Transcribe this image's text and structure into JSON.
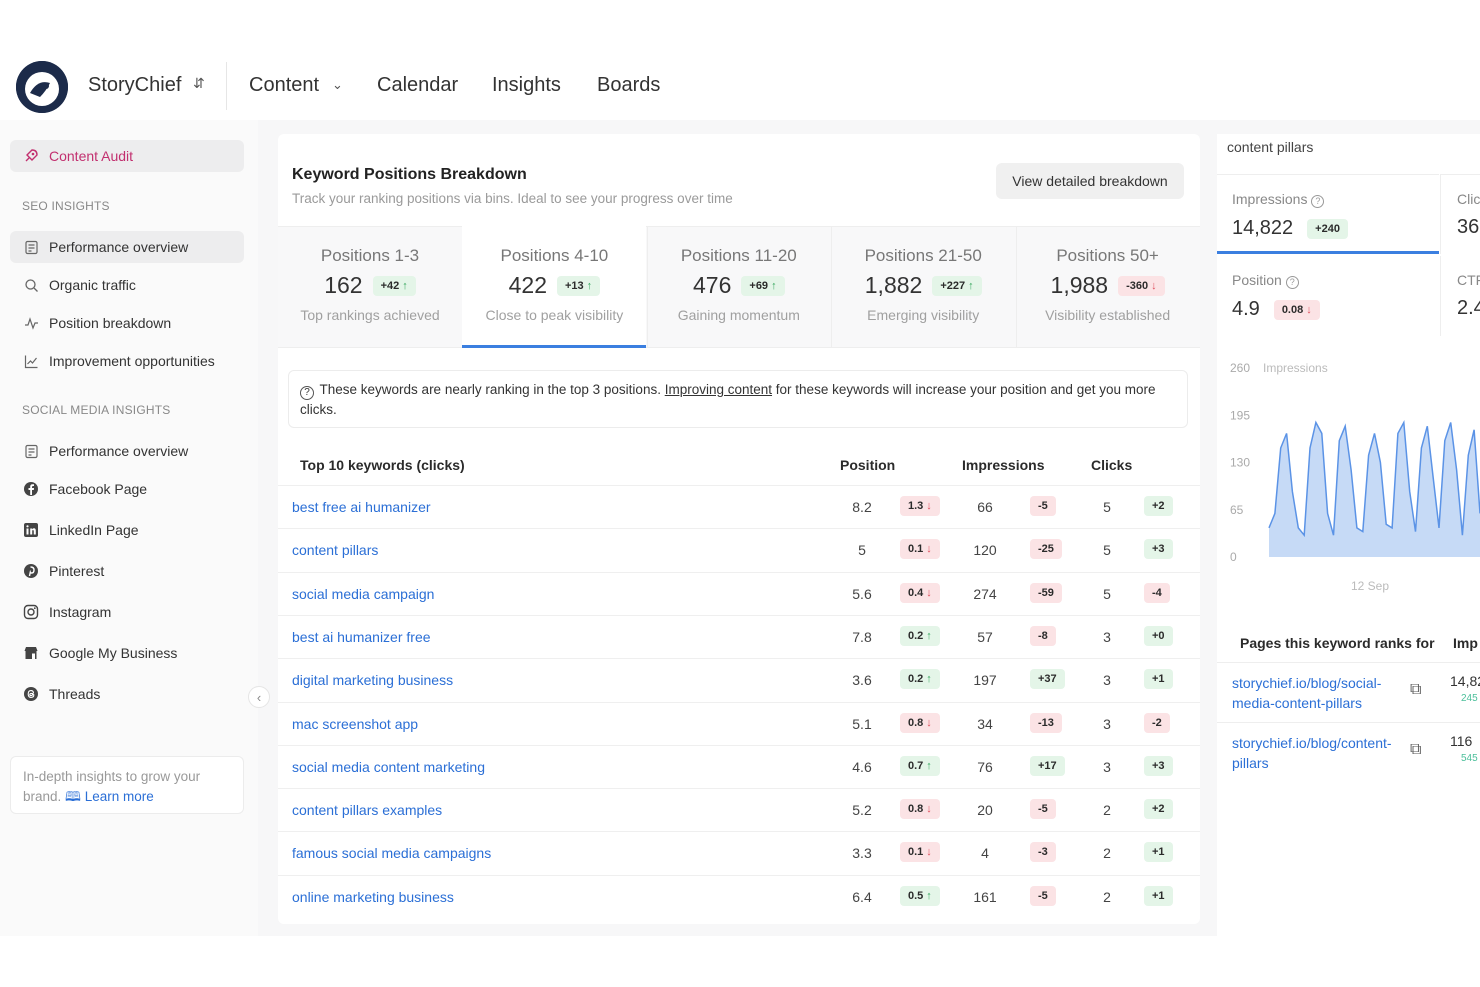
{
  "header": {
    "brand": "StoryChief",
    "nav": [
      {
        "label": "Content"
      },
      {
        "label": "Calendar"
      },
      {
        "label": "Insights"
      },
      {
        "label": "Boards"
      }
    ]
  },
  "sidebar": {
    "active": "Content Audit",
    "seo_section": "SEO INSIGHTS",
    "seo_items": [
      "Performance overview",
      "Organic traffic",
      "Position breakdown",
      "Improvement opportunities"
    ],
    "social_section": "SOCIAL MEDIA INSIGHTS",
    "social_items": [
      "Performance overview",
      "Facebook Page",
      "LinkedIn Page",
      "Pinterest",
      "Instagram",
      "Google My Business",
      "Threads"
    ],
    "promo_text": "In-depth insights to grow your brand.",
    "promo_link": "Learn more",
    "accent": "#c2306f"
  },
  "breakdown": {
    "title": "Keyword Positions Breakdown",
    "subtitle": "Track your ranking positions via bins. Ideal to see your progress over time",
    "button": "View detailed breakdown",
    "tabs": [
      {
        "label": "Positions 1-3",
        "value": "162",
        "delta": "+42",
        "dir": "up",
        "desc": "Top rankings achieved"
      },
      {
        "label": "Positions 4-10",
        "value": "422",
        "delta": "+13",
        "dir": "up",
        "desc": "Close to peak visibility"
      },
      {
        "label": "Positions 11-20",
        "value": "476",
        "delta": "+69",
        "dir": "up",
        "desc": "Gaining momentum"
      },
      {
        "label": "Positions 21-50",
        "value": "1,882",
        "delta": "+227",
        "dir": "up",
        "desc": "Emerging visibility"
      },
      {
        "label": "Positions 50+",
        "value": "1,988",
        "delta": "-360",
        "dir": "down",
        "desc": "Visibility established"
      }
    ],
    "active_tab": 1,
    "tip_before": "These keywords are nearly ranking in the top 3 positions.",
    "tip_link": "Improving content",
    "tip_after": "for these keywords will increase your position and get you more clicks.",
    "table_headers": {
      "keyword": "Top 10 keywords (clicks)",
      "position": "Position",
      "impressions": "Impressions",
      "clicks": "Clicks"
    },
    "rows": [
      {
        "kw": "best free ai humanizer",
        "pos": "8.2",
        "pos_d": "1.3",
        "pos_dir": "down",
        "imp": "66",
        "imp_d": "-5",
        "imp_c": "r",
        "clk": "5",
        "clk_d": "+2",
        "clk_c": "g"
      },
      {
        "kw": "content pillars",
        "pos": "5",
        "pos_d": "0.1",
        "pos_dir": "down",
        "imp": "120",
        "imp_d": "-25",
        "imp_c": "r",
        "clk": "5",
        "clk_d": "+3",
        "clk_c": "g"
      },
      {
        "kw": "social media campaign",
        "pos": "5.6",
        "pos_d": "0.4",
        "pos_dir": "down",
        "imp": "274",
        "imp_d": "-59",
        "imp_c": "r",
        "clk": "5",
        "clk_d": "-4",
        "clk_c": "r"
      },
      {
        "kw": "best ai humanizer free",
        "pos": "7.8",
        "pos_d": "0.2",
        "pos_dir": "up",
        "imp": "57",
        "imp_d": "-8",
        "imp_c": "r",
        "clk": "3",
        "clk_d": "+0",
        "clk_c": "g"
      },
      {
        "kw": "digital marketing business",
        "pos": "3.6",
        "pos_d": "0.2",
        "pos_dir": "up",
        "imp": "197",
        "imp_d": "+37",
        "imp_c": "g",
        "clk": "3",
        "clk_d": "+1",
        "clk_c": "g"
      },
      {
        "kw": "mac screenshot app",
        "pos": "5.1",
        "pos_d": "0.8",
        "pos_dir": "down",
        "imp": "34",
        "imp_d": "-13",
        "imp_c": "r",
        "clk": "3",
        "clk_d": "-2",
        "clk_c": "r"
      },
      {
        "kw": "social media content marketing",
        "pos": "4.6",
        "pos_d": "0.7",
        "pos_dir": "up",
        "imp": "76",
        "imp_d": "+17",
        "imp_c": "g",
        "clk": "3",
        "clk_d": "+3",
        "clk_c": "g"
      },
      {
        "kw": "content pillars examples",
        "pos": "5.2",
        "pos_d": "0.8",
        "pos_dir": "down",
        "imp": "20",
        "imp_d": "-5",
        "imp_c": "r",
        "clk": "2",
        "clk_d": "+2",
        "clk_c": "g"
      },
      {
        "kw": "famous social media campaigns",
        "pos": "3.3",
        "pos_d": "0.1",
        "pos_dir": "down",
        "imp": "4",
        "imp_d": "-3",
        "imp_c": "r",
        "clk": "2",
        "clk_d": "+1",
        "clk_c": "g"
      },
      {
        "kw": "online marketing business",
        "pos": "6.4",
        "pos_d": "0.5",
        "pos_dir": "up",
        "imp": "161",
        "imp_d": "-5",
        "imp_c": "r",
        "clk": "2",
        "clk_d": "+1",
        "clk_c": "g"
      }
    ]
  },
  "detail": {
    "keyword": "content pillars",
    "kpis": [
      {
        "label": "Impressions",
        "value": "14,822",
        "delta": "+240",
        "dir": "up"
      },
      {
        "label": "Position",
        "value": "4.9",
        "delta": "0.08",
        "dir": "down"
      }
    ],
    "kpi_side": [
      {
        "label": "Clic",
        "value": "36"
      },
      {
        "label": "CTF",
        "value": "2.4"
      }
    ],
    "pages_header": "Pages this keyword ranks for",
    "pages_col2": "Imp",
    "pages": [
      {
        "url": "storychief.io/blog/social-media-content-pillars",
        "imp": "14,82",
        "sub": "245"
      },
      {
        "url": "storychief.io/blog/content-pillars",
        "imp": "116",
        "sub": "545"
      }
    ]
  },
  "chart_data": {
    "type": "area",
    "ylabel": "Impressions",
    "yticks": [
      "260",
      "195",
      "130",
      "65",
      "0"
    ],
    "ylim": [
      0,
      260
    ],
    "x_label_tick": "12 Sep",
    "series": [
      {
        "values": [
          40,
          60,
          150,
          170,
          90,
          40,
          30,
          150,
          185,
          170,
          60,
          30,
          160,
          180,
          120,
          40,
          35,
          140,
          170,
          130,
          45,
          40,
          170,
          185,
          90,
          35,
          150,
          180,
          110,
          40,
          160,
          185,
          120,
          30,
          140,
          175,
          60
        ]
      }
    ],
    "color": "#5b93e6"
  }
}
